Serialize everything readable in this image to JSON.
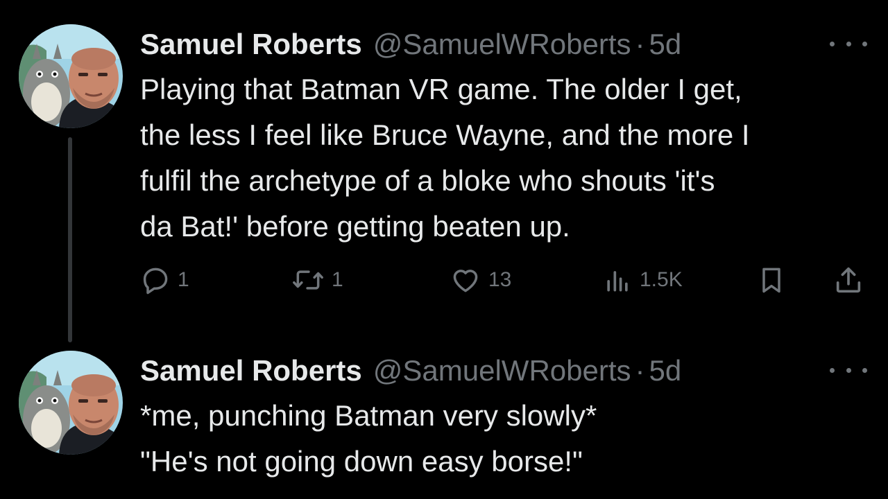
{
  "tweets": [
    {
      "author_name": "Samuel Roberts",
      "handle": "@SamuelWRoberts",
      "separator": "·",
      "time": "5d",
      "text": "Playing that Batman VR game. The older I get,\nthe less I feel like Bruce Wayne, and the more I\nfulfil the archetype of a bloke who shouts 'it's\nda Bat!' before getting beaten up.",
      "actions": {
        "replies": "1",
        "retweets": "1",
        "likes": "13",
        "views": "1.5K"
      }
    },
    {
      "author_name": "Samuel Roberts",
      "handle": "@SamuelWRoberts",
      "separator": "·",
      "time": "5d",
      "text": "*me, punching Batman very slowly*\n\"He's not going down easy borse!\""
    }
  ],
  "icons": {
    "reply": "reply-icon",
    "retweet": "retweet-icon",
    "like": "heart-icon",
    "views": "views-icon",
    "bookmark": "bookmark-icon",
    "share": "share-icon",
    "more": "more-icon"
  },
  "colors": {
    "background": "#000000",
    "primary_text": "#e7e9ea",
    "secondary_text": "#71767b",
    "thread_line": "#333639"
  }
}
